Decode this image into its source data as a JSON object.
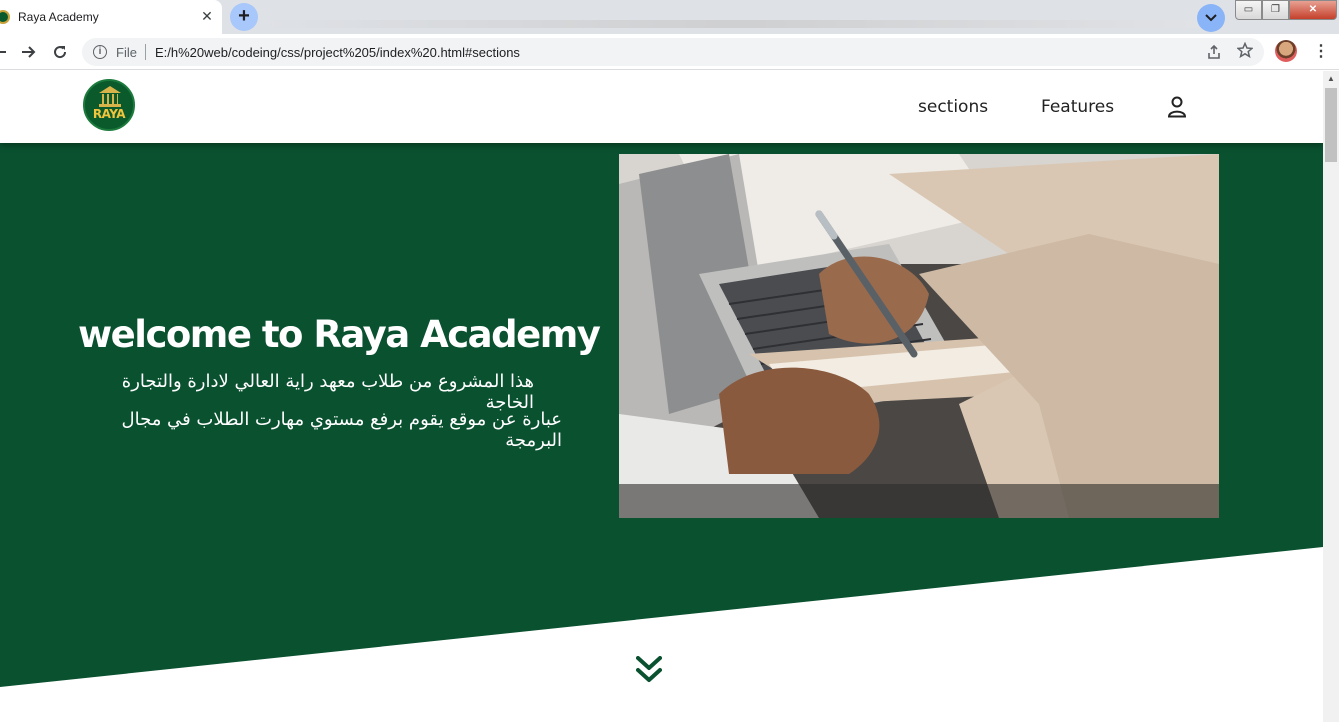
{
  "browser": {
    "tab_title": "Raya Academy",
    "tab_close": "✕",
    "newtab": "+",
    "omnibox": {
      "info": "i",
      "scheme_label": "File",
      "url": "E:/h%20web/codeing/css/project%205/index%20.html#sections"
    },
    "window_controls": {
      "minimize": "▭",
      "maximize": "❐",
      "close": "✕"
    },
    "icons": [
      "back-arrow-icon",
      "forward-arrow-icon",
      "reload-icon",
      "share-icon",
      "star-icon",
      "profile-avatar",
      "kebab-menu-icon"
    ]
  },
  "header": {
    "logo_text": "RAYA",
    "nav": {
      "sections": "sections",
      "features": "Features"
    },
    "icons": [
      "user-icon"
    ]
  },
  "hero": {
    "title": "welcome to Raya Academy",
    "line1": "هذا المشروع من طلاب معهد راية العالي لادارة والتجارة الخاجة",
    "line2": "عبارة عن موقع يقوم برفع مستوي مهارت الطلاب في مجال البرمجة",
    "scroll_icon": "double-chevron-down-icon"
  },
  "colors": {
    "brand_green": "#0a5130",
    "accent_gold": "#f0c43c",
    "tab_accent": "#a8c7fa"
  }
}
